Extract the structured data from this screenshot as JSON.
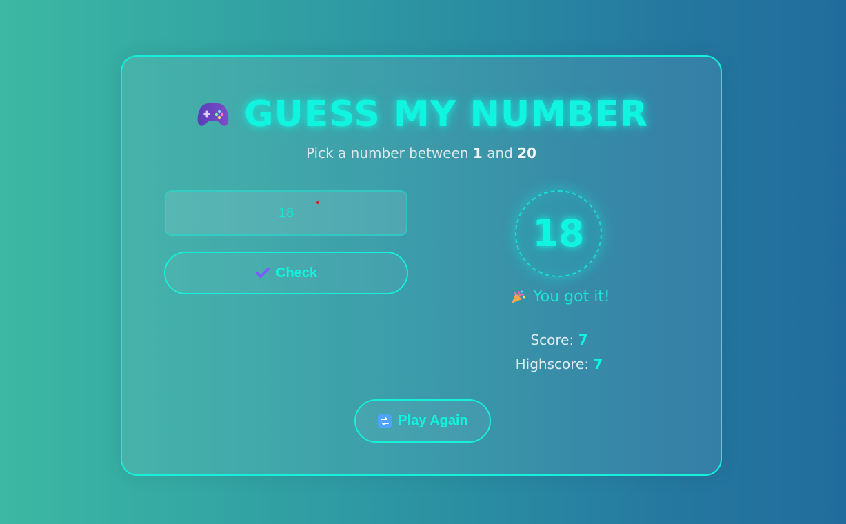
{
  "game": {
    "title": "GUESS MY NUMBER",
    "subtitle_prefix": "Pick a number between",
    "range_min": "1",
    "range_and": "and",
    "range_max": "20"
  },
  "input": {
    "value": "18"
  },
  "buttons": {
    "check": "Check",
    "play_again": "Play Again"
  },
  "display": {
    "secret_number": "18",
    "message": "You got it!",
    "score_label": "Score:",
    "score_value": "7",
    "highscore_label": "Highscore:",
    "highscore_value": "7"
  },
  "icons": {
    "controller": "game-controller-icon",
    "check": "check-icon",
    "party": "party-popper-icon",
    "replay": "replay-icon"
  },
  "colors": {
    "accent": "#11f4df",
    "text": "#dcecf0",
    "background_left": "#3cb8a3",
    "background_right": "#216c9c"
  }
}
